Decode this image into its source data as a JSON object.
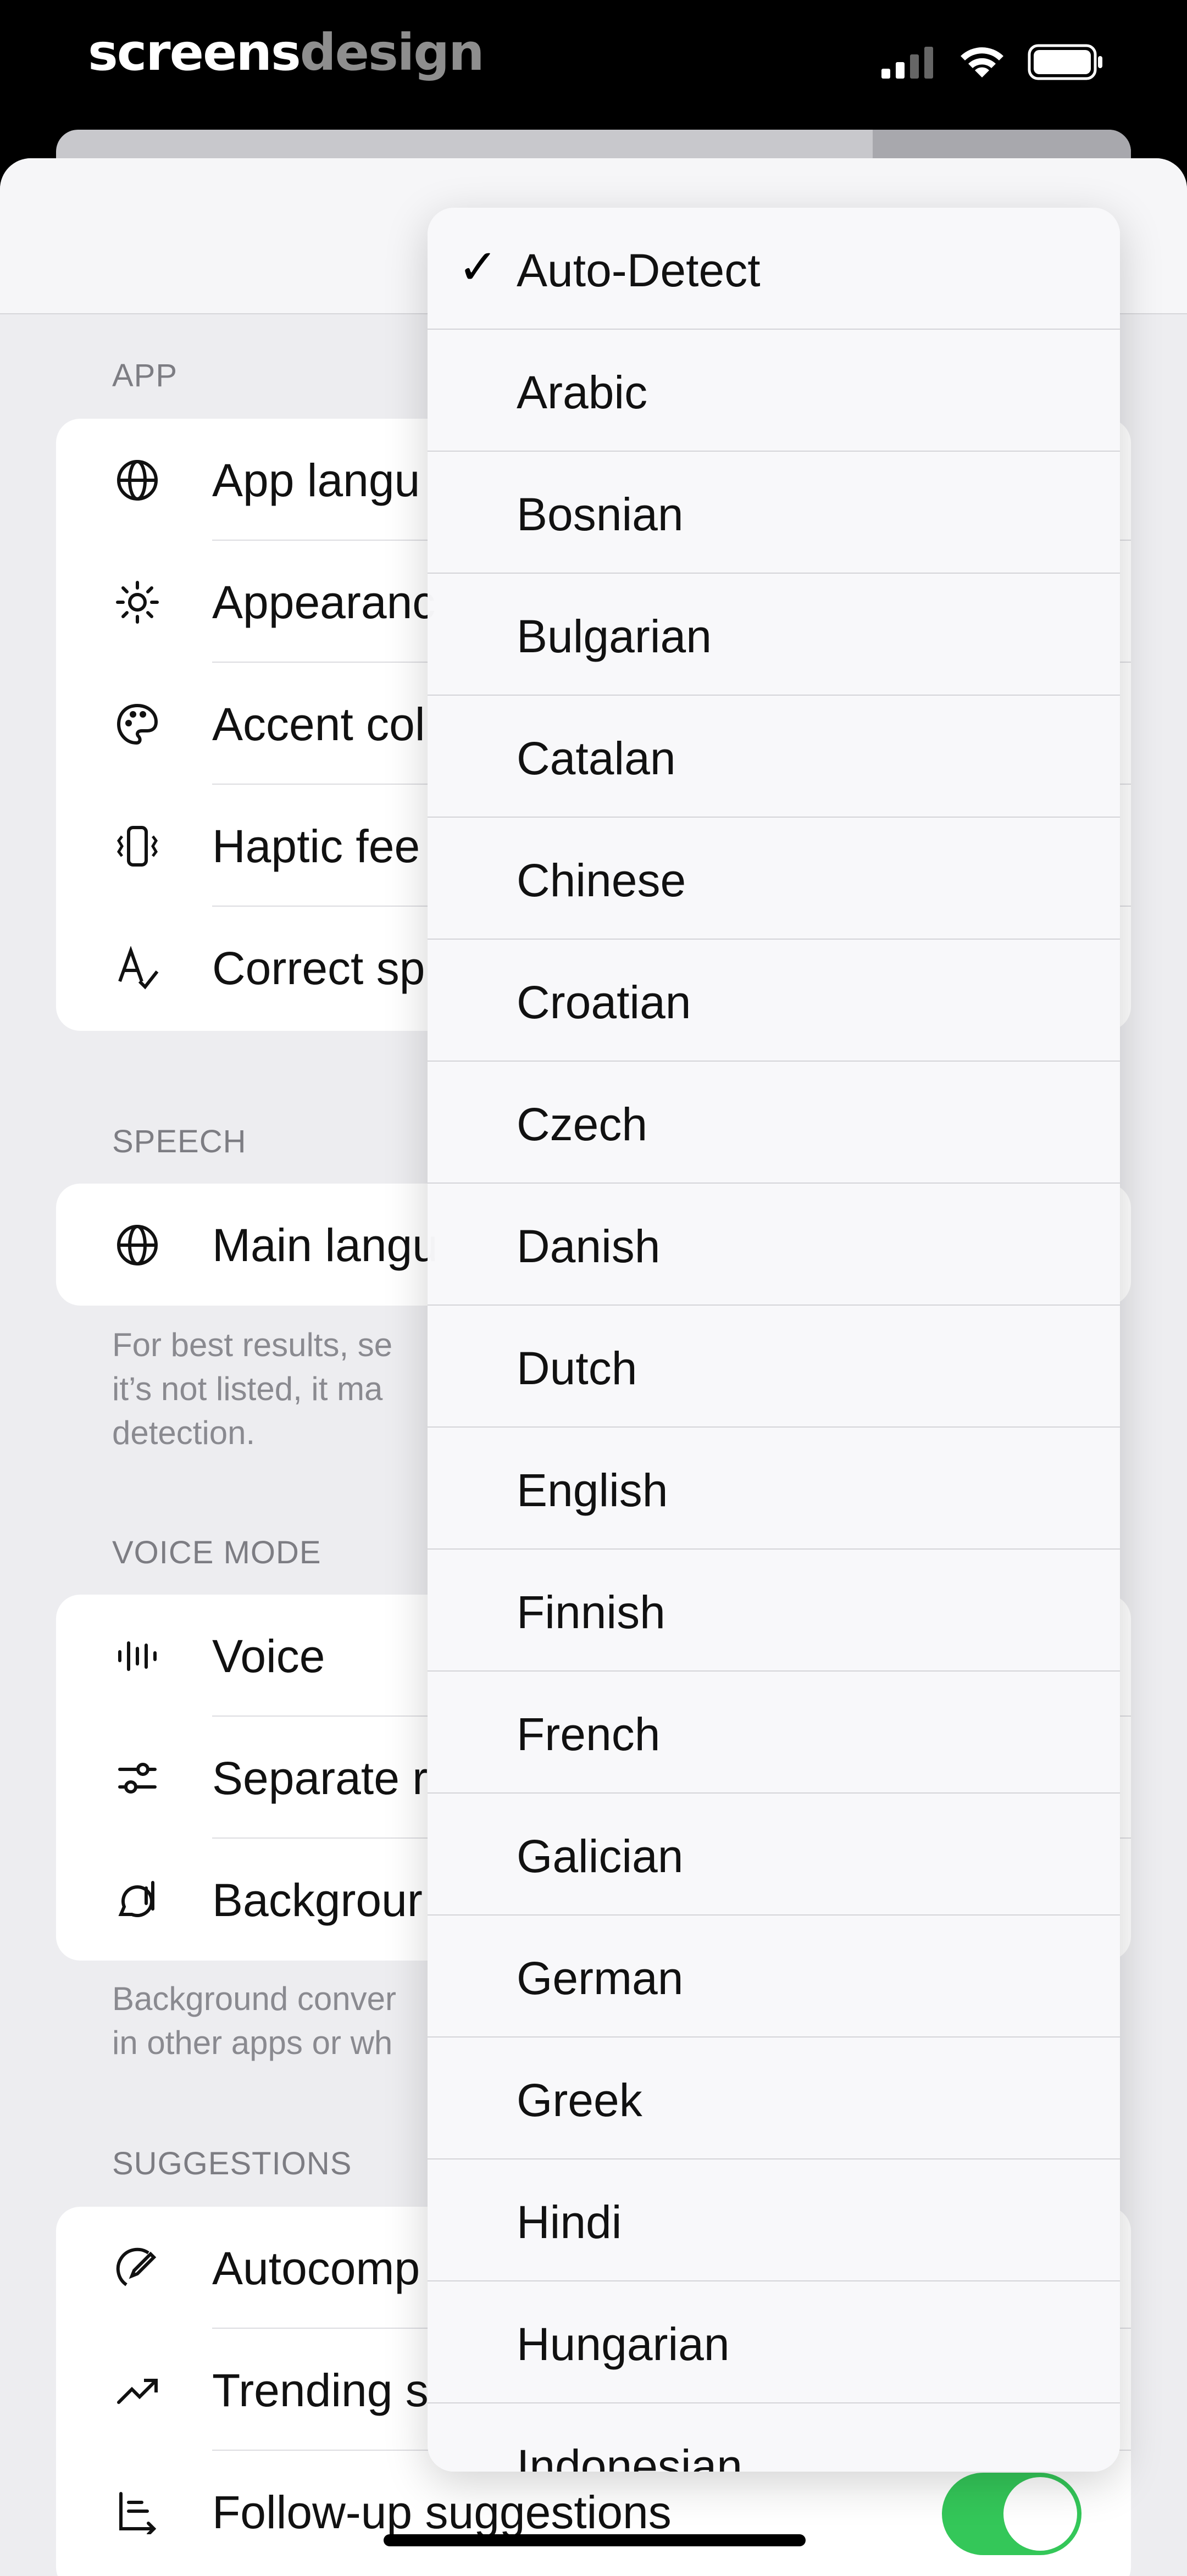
{
  "brand": {
    "part1": "screens",
    "part2": "design"
  },
  "sections": {
    "app": "APP",
    "speech": "SPEECH",
    "voice_mode": "VOICE MODE",
    "suggestions": "SUGGESTIONS"
  },
  "app_rows": [
    "App langu",
    "Appearanc",
    "Accent col",
    "Haptic fee",
    "Correct sp"
  ],
  "speech_rows": [
    "Main langu"
  ],
  "speech_footnote": [
    "For best results, se",
    "it’s not listed, it ma",
    "detection."
  ],
  "voice_rows": [
    "Voice",
    "Separate r",
    "Backgrour"
  ],
  "voice_footnote": [
    "Background conver",
    "in other apps or wh"
  ],
  "suggestion_rows": [
    "Autocomp",
    "Trending s",
    "Follow-up suggestions"
  ],
  "follow_up_toggle": {
    "on": true,
    "color": "#34c759"
  },
  "language_menu": {
    "selected": "Auto-Detect",
    "check_glyph": "✓",
    "options": [
      "Auto-Detect",
      "Arabic",
      "Bosnian",
      "Bulgarian",
      "Catalan",
      "Chinese",
      "Croatian",
      "Czech",
      "Danish",
      "Dutch",
      "English",
      "Finnish",
      "French",
      "Galician",
      "German",
      "Greek",
      "Hindi",
      "Hungarian",
      "Indonesian"
    ]
  },
  "icons": {
    "app": [
      "globe-icon",
      "sun-icon",
      "palette-icon",
      "haptic-icon",
      "spellcheck-icon"
    ],
    "speech": [
      "globe-icon"
    ],
    "voice": [
      "waveform-icon",
      "sliders-icon",
      "background-voice-icon"
    ],
    "suggestions": [
      "pencil-icon",
      "trending-icon",
      "follow-up-icon"
    ]
  }
}
